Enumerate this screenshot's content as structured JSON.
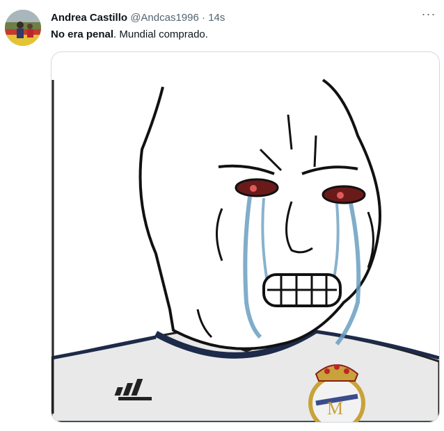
{
  "tweet": {
    "author_name": "Andrea Castillo",
    "handle": "@Andcas1996",
    "separator": "·",
    "time": "14s",
    "text_bold": "No era penal",
    "text_rest": ". Mundial comprado.",
    "more_label": "···"
  },
  "media": {
    "description_icon": "crying-wojak-meme"
  }
}
